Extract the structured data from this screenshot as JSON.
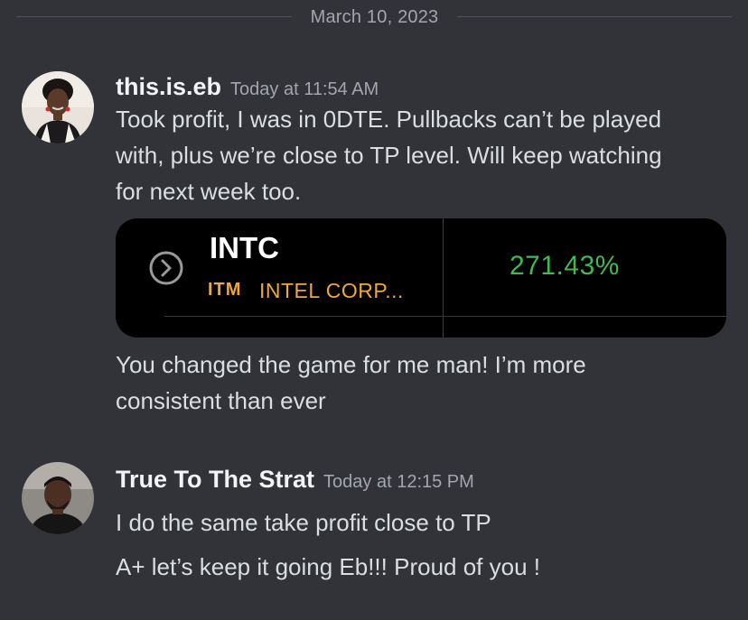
{
  "divider": {
    "date": "March 10, 2023"
  },
  "messages": [
    {
      "username": "this.is.eb",
      "timestamp": "Today at 11:54 AM",
      "lines": [
        "Took profit, I was in 0DTE. Pullbacks can’t be played",
        "with, plus we’re close to TP level. Will keep watching",
        "for next week too."
      ],
      "embed": {
        "ticker": "INTC",
        "badge": "ITM",
        "company": "INTEL CORP...",
        "percent": "271.43%",
        "icon": "chevron-right-circle-icon",
        "accent": "#f0a735",
        "gain_color": "#3fb950"
      },
      "followup_lines": [
        "You changed the game for me man! I’m more",
        "consistent than ever"
      ]
    },
    {
      "username": "True To The Strat",
      "timestamp": "Today at 12:15 PM",
      "lines": [
        "I do the same take profit close to TP",
        "A+ let’s keep it going Eb!!! Proud of you !"
      ]
    }
  ],
  "colors": {
    "background": "#313338",
    "text": "#dbdee1",
    "username": "#f2f3f5",
    "muted": "#a3a6ad"
  }
}
